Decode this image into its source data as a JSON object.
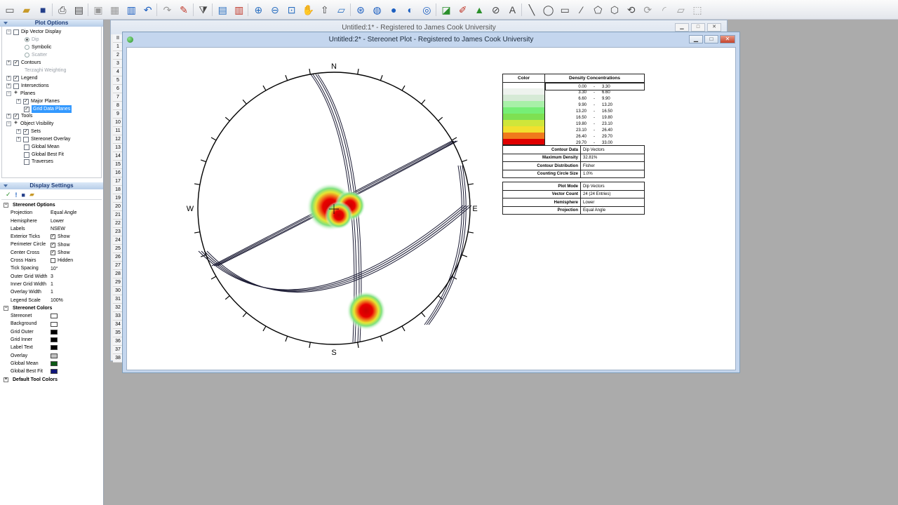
{
  "toolbar": {
    "icons": [
      "new-icon",
      "open-icon",
      "save-icon",
      "print-icon",
      "print-preview-icon",
      "copy-icon",
      "paste-icon",
      "columns-icon",
      "undo-icon",
      "redo-icon",
      "wand-icon",
      "filter-icon",
      "book-icon",
      "chart-icon",
      "zoom-in-icon",
      "zoom-out-icon",
      "zoom-window-icon",
      "pan-icon",
      "export-icon",
      "eraser-icon",
      "target-icon",
      "globe-icon",
      "sphere-icon",
      "sphere2-icon",
      "grid-sphere-icon",
      "plot-icon",
      "draw-icon",
      "cone-icon",
      "circle-slash-icon",
      "text-icon",
      "line-icon",
      "ellipse-icon",
      "rect-icon",
      "polyline-icon",
      "polygon-icon",
      "hexagon-icon",
      "undo-shape-icon",
      "redo-shape-icon",
      "arc-icon",
      "edit-icon",
      "select-icon"
    ]
  },
  "plot_options": {
    "header": "Plot Options",
    "tree": {
      "dip_vector_display": "Dip Vector Display",
      "dip": "Dip",
      "symbolic": "Symbolic",
      "scatter": "Scatter",
      "contours": "Contours",
      "terzaghi": "Terzaghi Weighting",
      "legend": "Legend",
      "intersections": "Intersections",
      "planes": "Planes",
      "major_planes": "Major Planes",
      "grid_data_planes": "Grid Data Planes",
      "tools": "Tools",
      "object_visibility": "Object Visibility",
      "sets": "Sets",
      "stereonet_overlay": "Stereonet Overlay",
      "global_mean": "Global Mean",
      "global_best_fit": "Global Best Fit",
      "traverses": "Traverses"
    }
  },
  "display_settings": {
    "header": "Display Settings",
    "stereonet_options": "Stereonet Options",
    "rows": [
      {
        "k": "Projection",
        "v": "Equal Angle"
      },
      {
        "k": "Hemisphere",
        "v": "Lower"
      },
      {
        "k": "Labels",
        "v": "NSEW"
      },
      {
        "k": "Exterior Ticks",
        "v": "Show"
      },
      {
        "k": "Perimeter Circle",
        "v": "Show"
      },
      {
        "k": "Center Cross",
        "v": "Show"
      },
      {
        "k": "Cross Hairs",
        "v": "Hidden"
      },
      {
        "k": "Tick Spacing",
        "v": "10°"
      },
      {
        "k": "Outer Grid Width",
        "v": "3"
      },
      {
        "k": "Inner Grid Width",
        "v": "1"
      },
      {
        "k": "Overlay Width",
        "v": "1"
      },
      {
        "k": "Legend Scale",
        "v": "100%"
      }
    ],
    "stereonet_colors": "Stereonet Colors",
    "colors": [
      {
        "k": "Stereonet",
        "c": "#ffffff"
      },
      {
        "k": "Background",
        "c": "#ffffff"
      },
      {
        "k": "Grid Outer",
        "c": "#000000"
      },
      {
        "k": "Grid Inner",
        "c": "#000000"
      },
      {
        "k": "Label Text",
        "c": "#000000"
      },
      {
        "k": "Overlay",
        "c": "#c0c0c0"
      },
      {
        "k": "Global Mean",
        "c": "#0b5a14"
      },
      {
        "k": "Global Best Fit",
        "c": "#10167a"
      }
    ],
    "default_tool_colors": "Default Tool Colors"
  },
  "window1": {
    "title": "Untitled:1* - Registered to James Cook University",
    "row_header": "II",
    "rows": [
      "1",
      "2",
      "3",
      "4",
      "5",
      "6",
      "7",
      "8",
      "9",
      "10",
      "11",
      "12",
      "13",
      "14",
      "15",
      "16",
      "17",
      "18",
      "19",
      "20",
      "21",
      "22",
      "23",
      "24",
      "25",
      "26",
      "27",
      "28",
      "29",
      "30",
      "31",
      "32",
      "33",
      "34",
      "35",
      "36",
      "37",
      "38"
    ]
  },
  "window2": {
    "title": "Untitled:2* - Stereonet Plot - Registered to James Cook University"
  },
  "stereonet": {
    "labels": {
      "n": "N",
      "s": "S",
      "e": "E",
      "w": "W"
    },
    "colors": {
      "hot": "#dd0000",
      "orange": "#f07a1c",
      "yellow": "#e6e633",
      "green": "#7ee07e"
    }
  },
  "legend": {
    "color_header": "Color",
    "density_header": "Density Concentrations",
    "ranges": [
      {
        "lo": "0.00",
        "hi": "3.30",
        "c": "#ffffff"
      },
      {
        "lo": "3.30",
        "hi": "6.60",
        "c": "#eef3ee"
      },
      {
        "lo": "6.60",
        "hi": "9.90",
        "c": "#d6ead6"
      },
      {
        "lo": "9.90",
        "hi": "13.20",
        "c": "#a8f0a8"
      },
      {
        "lo": "13.20",
        "hi": "16.50",
        "c": "#76ee76"
      },
      {
        "lo": "16.50",
        "hi": "19.80",
        "c": "#7ee052"
      },
      {
        "lo": "19.80",
        "hi": "23.10",
        "c": "#cfe63a"
      },
      {
        "lo": "23.10",
        "hi": "26.40",
        "c": "#f2e02e"
      },
      {
        "lo": "26.40",
        "hi": "29.70",
        "c": "#f07a1c"
      },
      {
        "lo": "29.70",
        "hi": "33.00",
        "c": "#e00000"
      }
    ],
    "dash": "-",
    "info1": [
      {
        "k": "Contour Data",
        "v": "Dip Vectors"
      },
      {
        "k": "Maximum Density",
        "v": "32.81%"
      },
      {
        "k": "Contour Distribution",
        "v": "Fisher"
      },
      {
        "k": "Counting Circle Size",
        "v": "1.0%"
      }
    ],
    "info2": [
      {
        "k": "Plot Mode",
        "v": "Dip Vectors"
      },
      {
        "k": "Vector Count",
        "v": "24 (24 Entries)"
      },
      {
        "k": "Hemisphere",
        "v": "Lower"
      },
      {
        "k": "Projection",
        "v": "Equal Angle"
      }
    ]
  }
}
